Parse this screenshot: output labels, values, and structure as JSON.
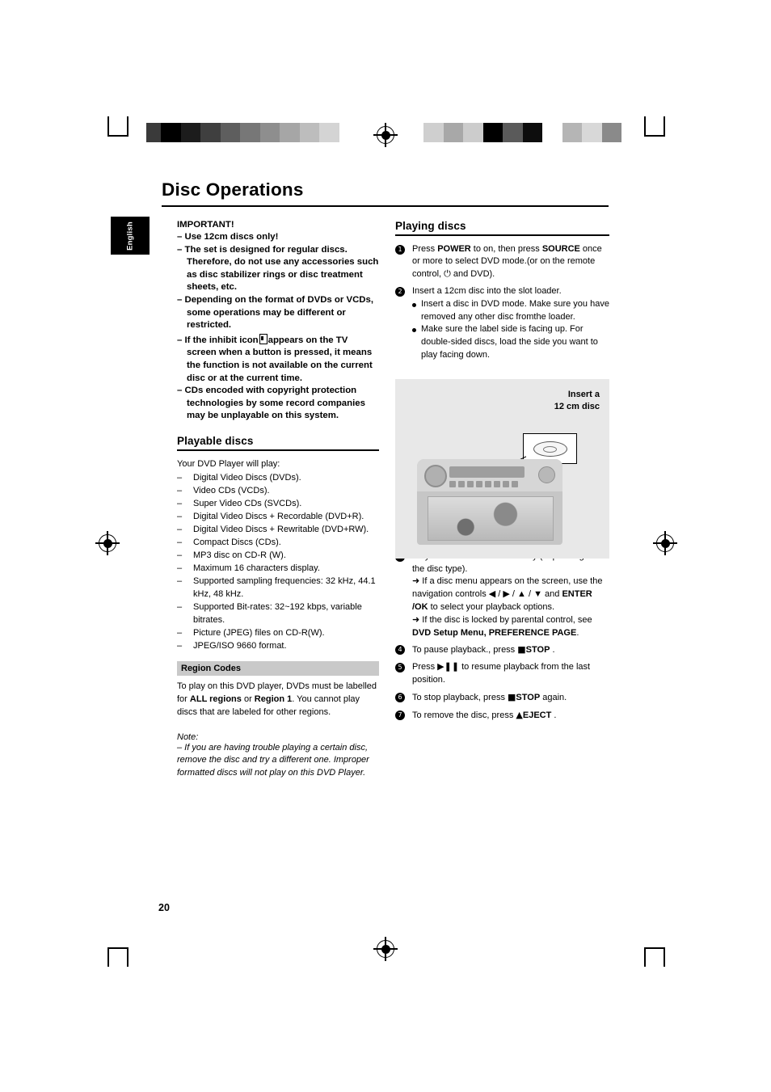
{
  "document": {
    "title": "Disc Operations",
    "language_tab": "English",
    "page_number": "20"
  },
  "left_column": {
    "important_heading": "IMPORTANT!",
    "important_items": [
      "–   Use 12cm  discs only!",
      "–   The set is designed for regular discs. Therefore, do not use any accessories such as disc stabilizer rings or disc treatment sheets, etc.",
      "–   Depending on the format of DVDs or VCDs, some operations may be different or restricted.",
      "–   If the inhibit icon ⊘ appears on the TV screen when a button is pressed, it means the function is not available on the current disc or at the current time.",
      "–   CDs encoded with copyright protection technologies by some record companies may be unplayable on this system."
    ],
    "playable_heading": "Playable discs",
    "playable_lead": "Your DVD Player will play:",
    "playable_items": [
      "Digital Video Discs (DVDs).",
      "Video CDs (VCDs).",
      "Super  Video CDs (SVCDs).",
      "Digital Video Discs + Recordable (DVD+R).",
      "Digital Video Discs + Rewritable (DVD+RW).",
      "Compact Discs (CDs).",
      "MP3 disc on CD-R (W).",
      "Maximum 16 characters display.",
      "Supported sampling frequencies: 32 kHz, 44.1 kHz, 48 kHz.",
      "Supported Bit-rates: 32~192 kbps, variable bitrates.",
      "Picture (JPEG) files on CD-R(W).",
      "JPEG/ISO 9660 format."
    ],
    "region_heading": "Region Codes",
    "region_text_1": "To play on this DVD player, DVDs must be labelled for ",
    "region_bold_all": "ALL regions",
    "region_text_2": " or ",
    "region_bold_r1": "Region 1",
    "region_text_3": ". You cannot play discs that are labeled for other regions.",
    "note_label": "Note:",
    "note_text": "–  If you are having trouble playing a certain disc, remove the disc and try a different one. Improper formatted discs will not play on this DVD Player."
  },
  "right_column": {
    "playing_heading": "Playing discs",
    "step1": {
      "num": "1",
      "text_a": "Press ",
      "bold_power": "POWER",
      "text_b": " to on, then press ",
      "bold_source": "SOURCE",
      "text_c": " once or more to select DVD mode.(or on the remote control, ⏻ and DVD)."
    },
    "step2": {
      "num": "2",
      "text": "Insert a 12cm disc into the slot loader.",
      "bullets": [
        "Insert a disc in DVD mode. Make sure you have removed any other disc fromthe loader.",
        "Make sure the label side is facing up. For double-sided discs, load the side you want to play facing down."
      ]
    },
    "step3": {
      "num": "3",
      "text": "Playback will start automatically (depending on the disc type).",
      "arrow1_a": "➜ If a disc menu appears on the screen, use the navigation controls ◀ / ▶ / ▲ / ▼ and ",
      "arrow1_bold": "ENTER /OK",
      "arrow1_b": " to select your playback options.",
      "arrow2_a": "➜ If the disc is locked by parental control, see ",
      "arrow2_bold": "DVD Setup Menu,  PREFERENCE PAGE",
      "arrow2_b": "."
    },
    "step4": {
      "num": "4",
      "text_a": "To pause playback., press ",
      "bold": "STOP",
      "text_b": " ."
    },
    "step5": {
      "num": "5",
      "text": "Press ▶❚❚ to resume playback from the last position."
    },
    "step6": {
      "num": "6",
      "text_a": "To stop playback, press ",
      "bold": "STOP",
      "text_b": " again."
    },
    "step7": {
      "num": "7",
      "text_a": "To remove the disc, press ",
      "bold": "EJECT",
      "text_b": " ."
    },
    "illustration": {
      "caption_line1": "Insert  a",
      "caption_line2": "12 cm disc"
    }
  },
  "print_marks": {
    "left_swatches": [
      "#3a3a3a",
      "#000000",
      "#1c1c1c",
      "#3f3f3f",
      "#5e5e5e",
      "#777777",
      "#8e8e8e",
      "#a6a6a6",
      "#bdbdbd",
      "#d4d4d4",
      "#ffffff"
    ],
    "right_swatches": [
      "#cfcfcf",
      "#a8a8a8",
      "#cccccc",
      "#000000",
      "#5a5a5a",
      "#0d0d0d",
      "#ffffff",
      "#b5b5b5",
      "#d8d8d8",
      "#8a8a8a"
    ]
  }
}
